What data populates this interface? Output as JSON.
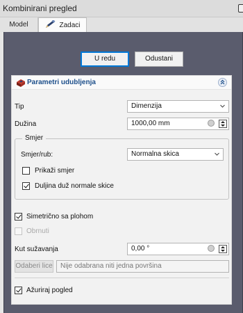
{
  "window": {
    "title": "Kombinirani pregled"
  },
  "tabs": [
    {
      "label": "Model"
    },
    {
      "label": "Zadaci"
    }
  ],
  "dialog_buttons": {
    "ok": "U redu",
    "cancel": "Odustani"
  },
  "panel": {
    "title": "Parametri udubljenja",
    "type_label": "Tip",
    "type_value": "Dimenzija",
    "length_label": "Dužina",
    "length_value": "1000,00 mm",
    "direction_group": {
      "title": "Smjer",
      "edge_label": "Smjer/rub:",
      "edge_value": "Normalna skica",
      "show_direction_label": "Prikaži smjer",
      "show_direction_checked": false,
      "along_normal_label": "Duljina duž normale skice",
      "along_normal_checked": true
    },
    "symmetric_label": "Simetrično sa plohom",
    "symmetric_checked": true,
    "reversed_label": "Obrnuti",
    "reversed_checked": false,
    "taper_label": "Kut sužavanja",
    "taper_value": "0,00 °",
    "select_face_button": "Odaberi lice",
    "face_value": "Nije odabrana niti jedna površina",
    "update_view_label": "Ažuriraj pogled",
    "update_view_checked": true
  },
  "colors": {
    "content_background": "#5a5c6d",
    "panel_title": "#1c4e8a",
    "ok_button_border": "#0078d7"
  }
}
